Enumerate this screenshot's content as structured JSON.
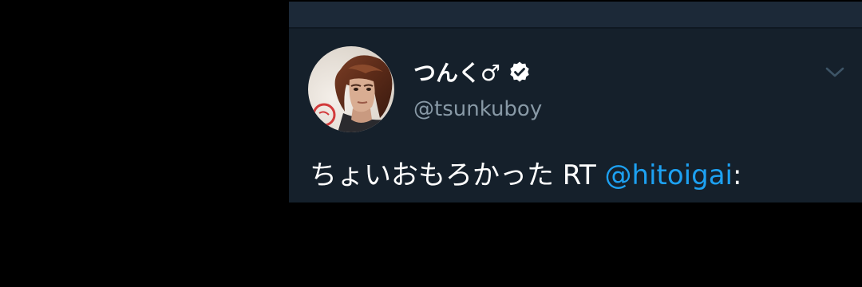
{
  "tweet": {
    "display_name": "つんく♂",
    "handle": "@tsunkuboy",
    "text_prefix": "ちょいおもろかった RT ",
    "mention": "@hitoigai",
    "text_suffix": ":",
    "verified": true
  },
  "icons": {
    "verified": "verified-badge-icon",
    "menu": "chevron-down-icon",
    "avatar": "profile-photo"
  },
  "colors": {
    "page_background": "#000000",
    "card_background": "#15202b",
    "top_strip": "#1c2938",
    "primary_text": "#ffffff",
    "secondary_text": "#8899a6",
    "link": "#1da1f2"
  }
}
